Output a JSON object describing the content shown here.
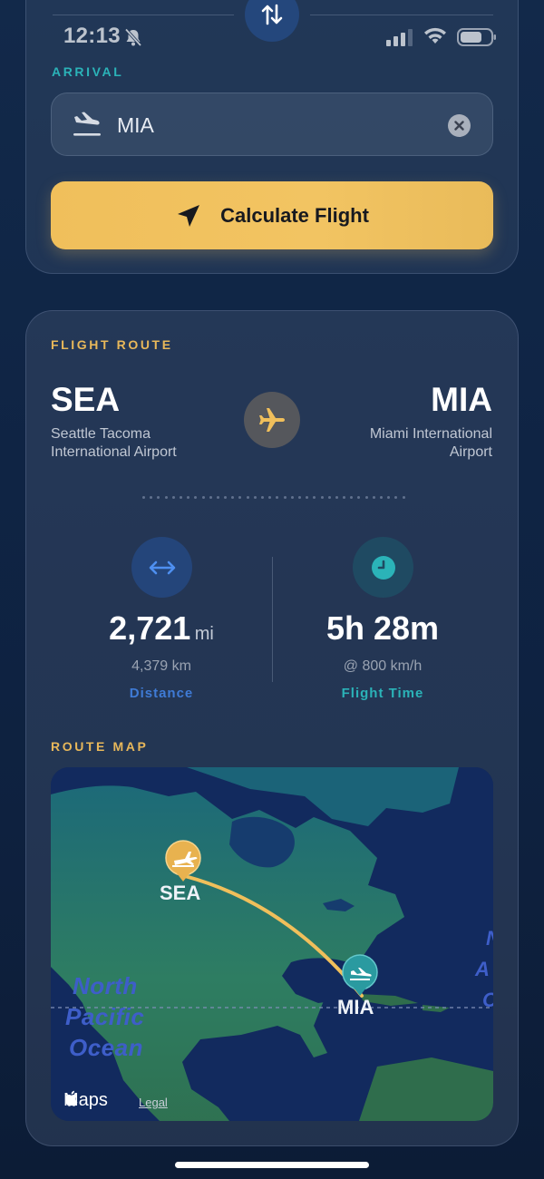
{
  "status_bar": {
    "time": "12:13"
  },
  "arrival": {
    "section_label": "ARRIVAL",
    "value": "MIA"
  },
  "calculate_button": {
    "label": "Calculate Flight"
  },
  "flight_route": {
    "section_label": "FLIGHT ROUTE",
    "origin": {
      "code": "SEA",
      "name_line1": "Seattle Tacoma",
      "name_line2": "International Airport"
    },
    "destination": {
      "code": "MIA",
      "name_line1": "Miami International",
      "name_line2": "Airport"
    }
  },
  "stats": {
    "distance": {
      "value": "2,721",
      "unit": "mi",
      "secondary": "4,379 km",
      "label": "Distance"
    },
    "flight_time": {
      "value": "5h 28m",
      "secondary": "@ 800 km/h",
      "label": "Flight Time"
    }
  },
  "route_map": {
    "section_label": "ROUTE MAP",
    "origin_pin": "SEA",
    "destination_pin": "MIA",
    "ocean_label_1": "North",
    "ocean_label_2": "Pacific",
    "ocean_label_3": "Ocean",
    "edge_label_1": "N",
    "edge_label_2": "A",
    "edge_label_3": "O",
    "maps_brand": "Maps",
    "legal_link": "Legal"
  },
  "colors": {
    "accent_gold": "#f0bf5b",
    "accent_teal": "#2bb3b8",
    "accent_blue": "#3f7bd6"
  }
}
